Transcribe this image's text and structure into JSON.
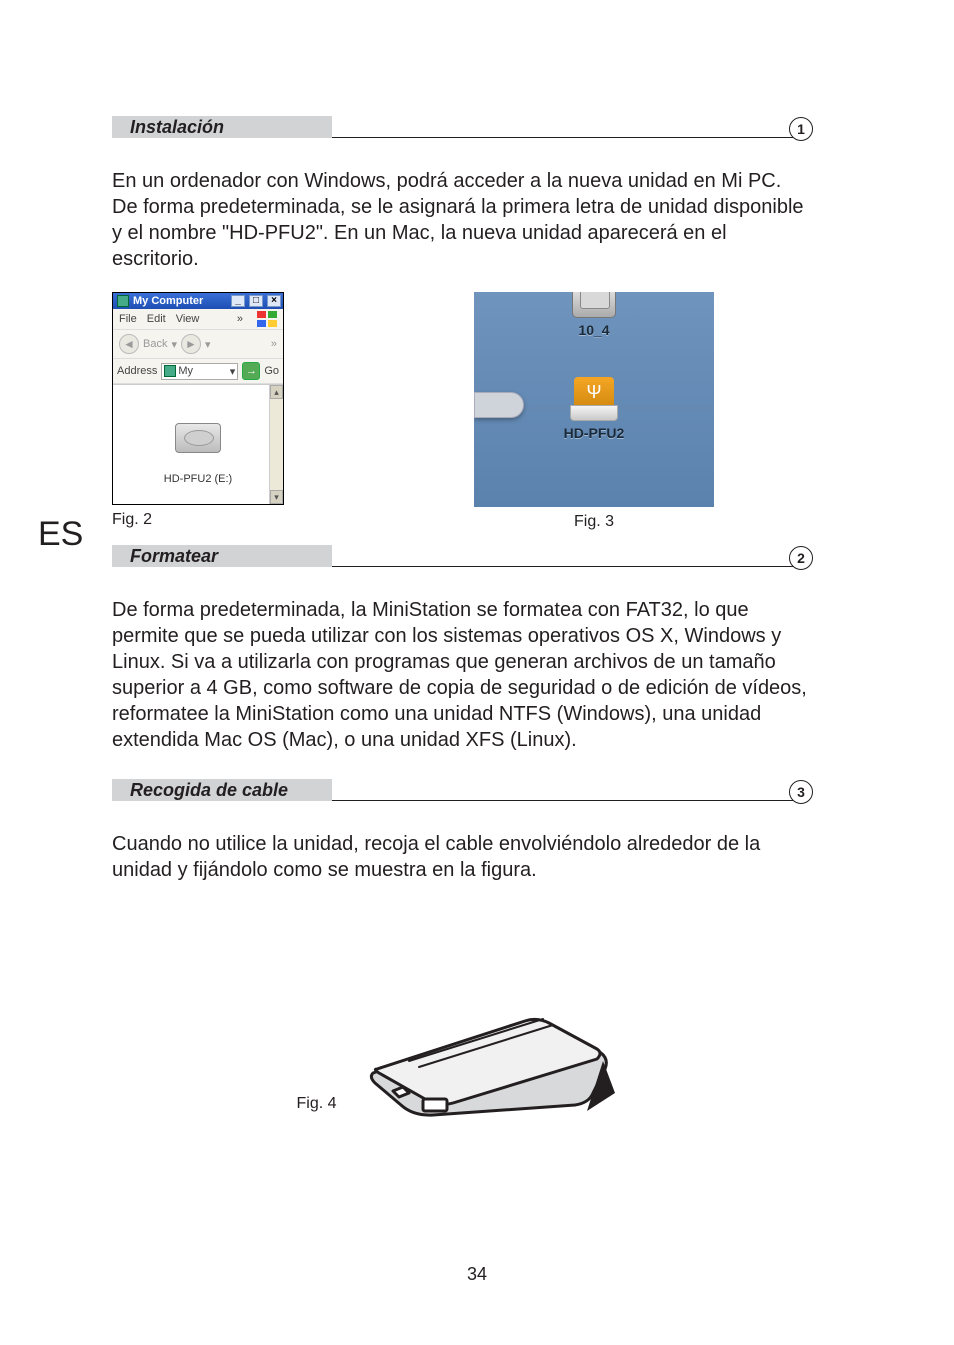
{
  "language_code": "ES",
  "page_number": "34",
  "sections": [
    {
      "title": "Instalación",
      "number": "1",
      "body": "En un ordenador con Windows, podrá acceder a la nueva unidad en Mi PC. De forma predeterminada, se le asignará la primera letra de unidad disponible y el nombre \"HD-PFU2\". En un Mac, la nueva unidad aparecerá en el escritorio."
    },
    {
      "title": "Formatear",
      "number": "2",
      "body": "De forma predeterminada, la MiniStation se formatea con FAT32, lo que permite que se pueda utilizar con los sistemas operativos OS X, Windows y Linux. Si va a utilizarla con programas que generan archivos de un tamaño superior a 4 GB, como software de copia de seguridad o de edición de vídeos, reformatee la MiniStation como una unidad NTFS (Windows), una unidad extendida Mac OS (Mac), o una unidad XFS (Linux)."
    },
    {
      "title": "Recogida de cable",
      "number": "3",
      "body": "Cuando no utilice la unidad, recoja el cable envolviéndolo alrededor de la unidad y fijándolo como se muestra en la figura."
    }
  ],
  "figures": {
    "fig2_caption": "Fig. 2",
    "fig3_caption": "Fig. 3",
    "fig4_caption": "Fig. 4"
  },
  "win_window": {
    "title": "My Computer",
    "menu": {
      "file": "File",
      "edit": "Edit",
      "view": "View",
      "more": "»"
    },
    "toolbar": {
      "back": "Back",
      "more": "»"
    },
    "address": {
      "label": "Address",
      "value": "My",
      "go": "Go"
    },
    "drive_label": "HD-PFU2 (E:)"
  },
  "mac_desktop": {
    "hdd_label": "10_4",
    "usb_label": "HD-PFU2",
    "usb_symbol": "⎘"
  }
}
